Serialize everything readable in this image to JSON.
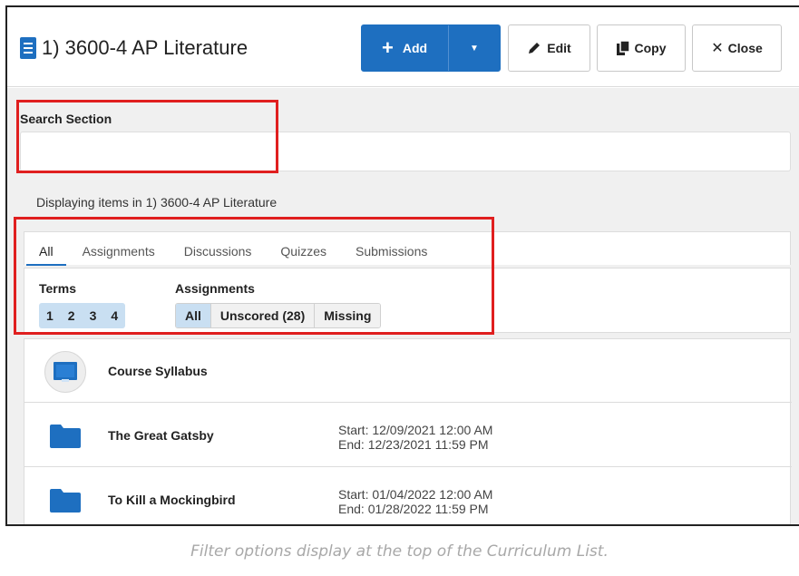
{
  "header": {
    "title": "1) 3600-4 AP Literature",
    "buttons": {
      "add": "Add",
      "edit": "Edit",
      "copy": "Copy",
      "close": "Close"
    }
  },
  "search": {
    "label": "Search Section",
    "value": "",
    "placeholder": ""
  },
  "display_text": "Displaying items in 1) 3600-4 AP Literature",
  "tabs": [
    {
      "label": "All",
      "active": true
    },
    {
      "label": "Assignments",
      "active": false
    },
    {
      "label": "Discussions",
      "active": false
    },
    {
      "label": "Quizzes",
      "active": false
    },
    {
      "label": "Submissions",
      "active": false
    }
  ],
  "filters": {
    "terms": {
      "label": "Terms",
      "options": [
        "1",
        "2",
        "3",
        "4"
      ]
    },
    "assignments": {
      "label": "Assignments",
      "options": [
        "All",
        "Unscored (28)",
        "Missing"
      ],
      "selected": "All"
    }
  },
  "items": [
    {
      "name": "Course Syllabus",
      "icon": "syllabus-icon",
      "start": "",
      "end": ""
    },
    {
      "name": "The Great Gatsby",
      "icon": "folder-icon",
      "start": "Start: 12/09/2021 12:00 AM",
      "end": "End: 12/23/2021 11:59 PM"
    },
    {
      "name": "To Kill a Mockingbird",
      "icon": "folder-icon",
      "start": "Start: 01/04/2022 12:00 AM",
      "end": "End: 01/28/2022 11:59 PM"
    }
  ],
  "caption": "Filter options display at the top of the Curriculum List.",
  "colors": {
    "primary": "#1e6fc0",
    "highlight": "#e01f1f",
    "selected_pill": "#c9dff2"
  }
}
